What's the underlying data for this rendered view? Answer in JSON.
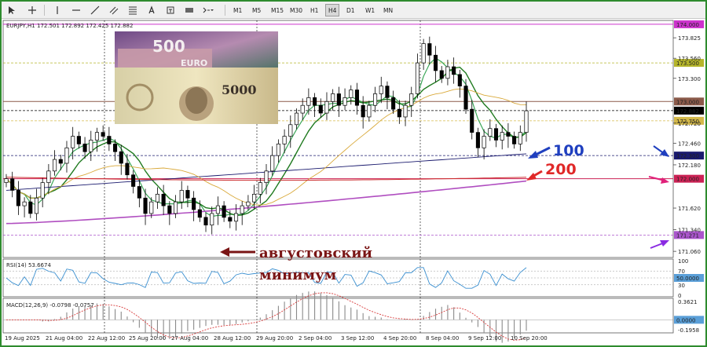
{
  "toolbar": {
    "icons": [
      "cursor-icon",
      "crosshair-icon",
      "vertical-line-icon",
      "horizontal-line-icon",
      "trendline-icon",
      "channel-icon",
      "fibonacci-icon",
      "text-icon",
      "label-icon",
      "rectangle-icon",
      "shapes-icon"
    ],
    "timeframes": [
      "M1",
      "M5",
      "M15",
      "M30",
      "H1",
      "H4",
      "D1",
      "W1",
      "MN"
    ],
    "active_timeframe": "H4"
  },
  "chart": {
    "header": "EURJPY,H1  172.501 172.892 172.425 172.882",
    "price_labels": [
      "173.825",
      "173.560",
      "173.300",
      "172.720",
      "172.460",
      "172.180",
      "171.620",
      "171.340",
      "171.060"
    ],
    "highlighted_levels": [
      {
        "text": "174.000",
        "price": 174.0,
        "color": "#cc33cc"
      },
      {
        "text": "173.500",
        "price": 173.5,
        "color": "#b5b52a"
      },
      {
        "text": "173.000",
        "price": 173.0,
        "color": "#8b5a4a"
      },
      {
        "text": "172.882",
        "price": 172.882,
        "color": "#000000"
      },
      {
        "text": "172.750",
        "price": 172.75,
        "color": "#d4b94a"
      },
      {
        "text": "172.300",
        "price": 172.3,
        "color": "#1a1a6e"
      },
      {
        "text": "172.000",
        "price": 172.0,
        "color": "#cc2255"
      },
      {
        "text": "171.271",
        "price": 171.271,
        "color": "#aa55cc"
      }
    ],
    "time_labels": [
      "19 Aug 2025",
      "21 Aug 04:00",
      "22 Aug 12:00",
      "25 Aug 20:00",
      "27 Aug 04:00",
      "28 Aug 12:00",
      "29 Aug 20:00",
      "2 Sep 04:00",
      "3 Sep 12:00",
      "4 Sep 20:00",
      "8 Sep 04:00",
      "9 Sep 12:00",
      "10 Sep 20:00"
    ],
    "rsi_label": "RSI(14) 53.6674",
    "rsi_levels": [
      "100",
      "70",
      "50.0000",
      "30",
      "0"
    ],
    "macd_label": "MACD(12,26,9) -0.0798 -0.0757",
    "macd_levels": [
      "0.3621",
      "0.0000",
      "-0.1958"
    ]
  },
  "annotations": {
    "ma100": "100",
    "ma200": "200",
    "august_low_line1": "августовский",
    "august_low_line2": "минимум"
  },
  "banknote_image": {
    "text_500": "500",
    "text_euro": "EURO",
    "text_5000": "5000"
  }
}
